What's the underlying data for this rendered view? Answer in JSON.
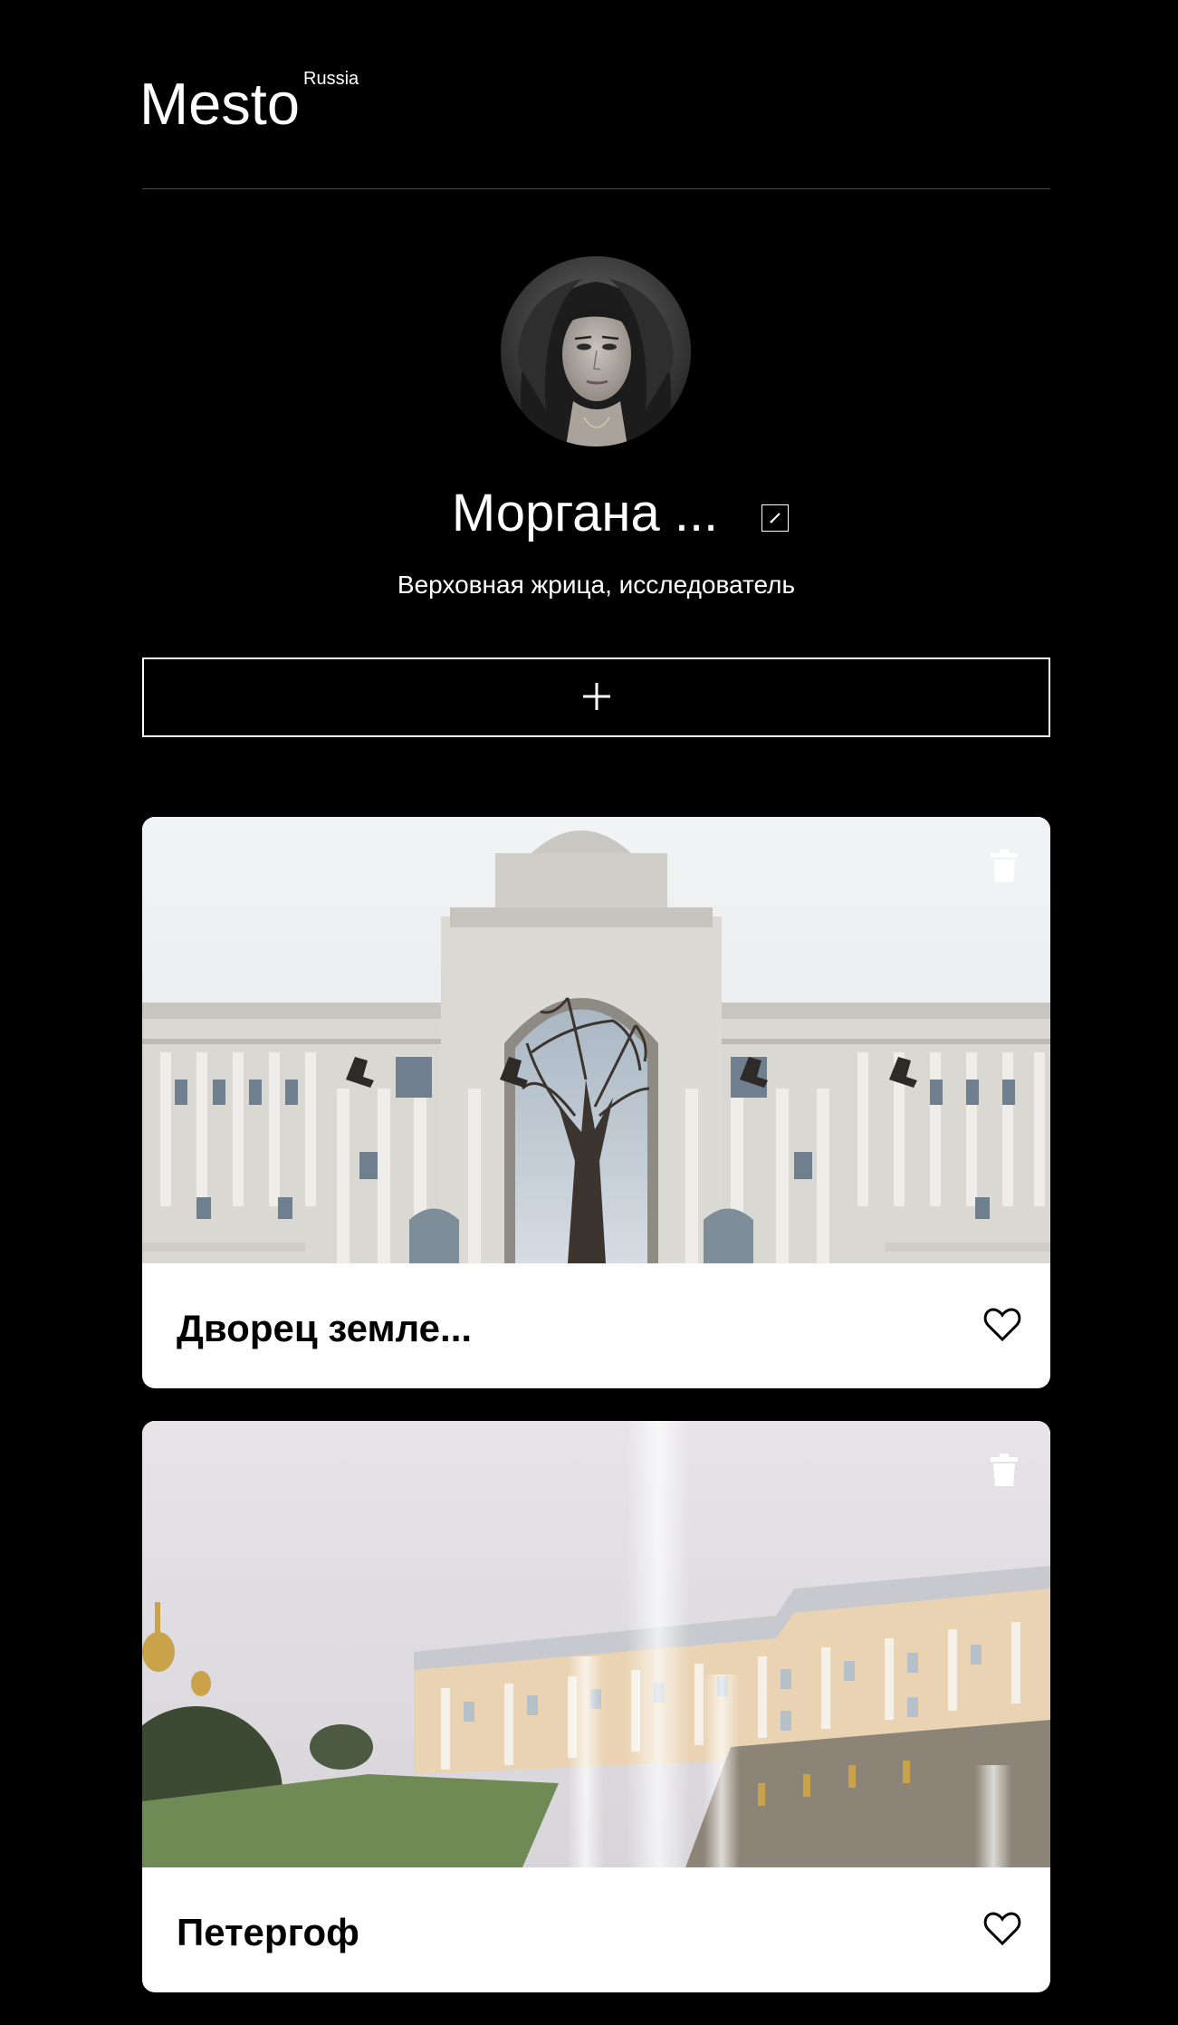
{
  "header": {
    "logo": "Mesto",
    "logo_sup": "Russia"
  },
  "profile": {
    "name": "Моргана ...",
    "about": "Верховная жрица, исследователь",
    "avatar_icon": "avatar-photo",
    "edit_icon": "pencil-icon",
    "add_icon": "plus-icon"
  },
  "cards": [
    {
      "title": "Дворец земле...",
      "image": "palace-with-tree-arch-photo",
      "like_icon": "heart-outline-icon",
      "delete_icon": "trash-icon"
    },
    {
      "title": "Петергоф",
      "image": "peterhof-fountain-photo",
      "like_icon": "heart-outline-icon",
      "delete_icon": "trash-icon"
    }
  ],
  "colors": {
    "background": "#000000",
    "card": "#ffffff",
    "divider": "#545454"
  }
}
